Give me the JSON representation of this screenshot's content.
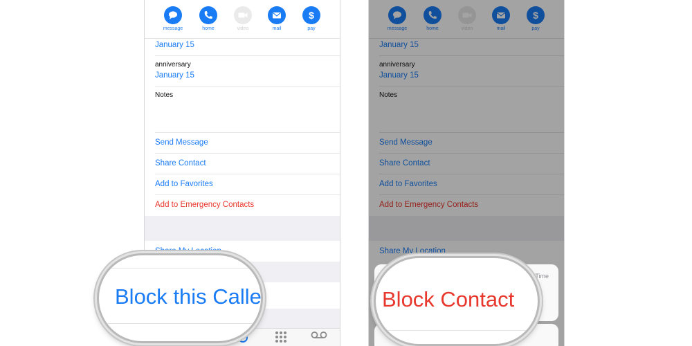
{
  "colors": {
    "accent": "#1a7cf5",
    "destructive": "#e8372c",
    "group_background": "#efeff4"
  },
  "action_buttons": [
    {
      "label": "message",
      "icon": "speech-bubble-icon",
      "enabled": true
    },
    {
      "label": "home",
      "icon": "phone-icon",
      "enabled": true
    },
    {
      "label": "video",
      "icon": "video-camera-icon",
      "enabled": false
    },
    {
      "label": "mail",
      "icon": "envelope-icon",
      "enabled": true
    },
    {
      "label": "pay",
      "icon": "dollar-icon",
      "enabled": true,
      "glyph": "$"
    }
  ],
  "fields": {
    "date_value": "January 15",
    "anniversary_label": "anniversary",
    "anniversary_value": "January 15",
    "notes_label": "Notes"
  },
  "contact_actions": {
    "send_message": "Send Message",
    "share_contact": "Share Contact",
    "add_favorites": "Add to Favorites",
    "add_emergency": "Add to Emergency Contacts",
    "share_location": "Share My Location"
  },
  "tab_icons": [
    "recents-icon",
    "keypad-icon",
    "voicemail-icon"
  ],
  "left_magnified": {
    "text": "Block this Calle"
  },
  "right_sheet": {
    "partial_text": "Time"
  },
  "right_magnified": {
    "text": "Block Contact"
  }
}
